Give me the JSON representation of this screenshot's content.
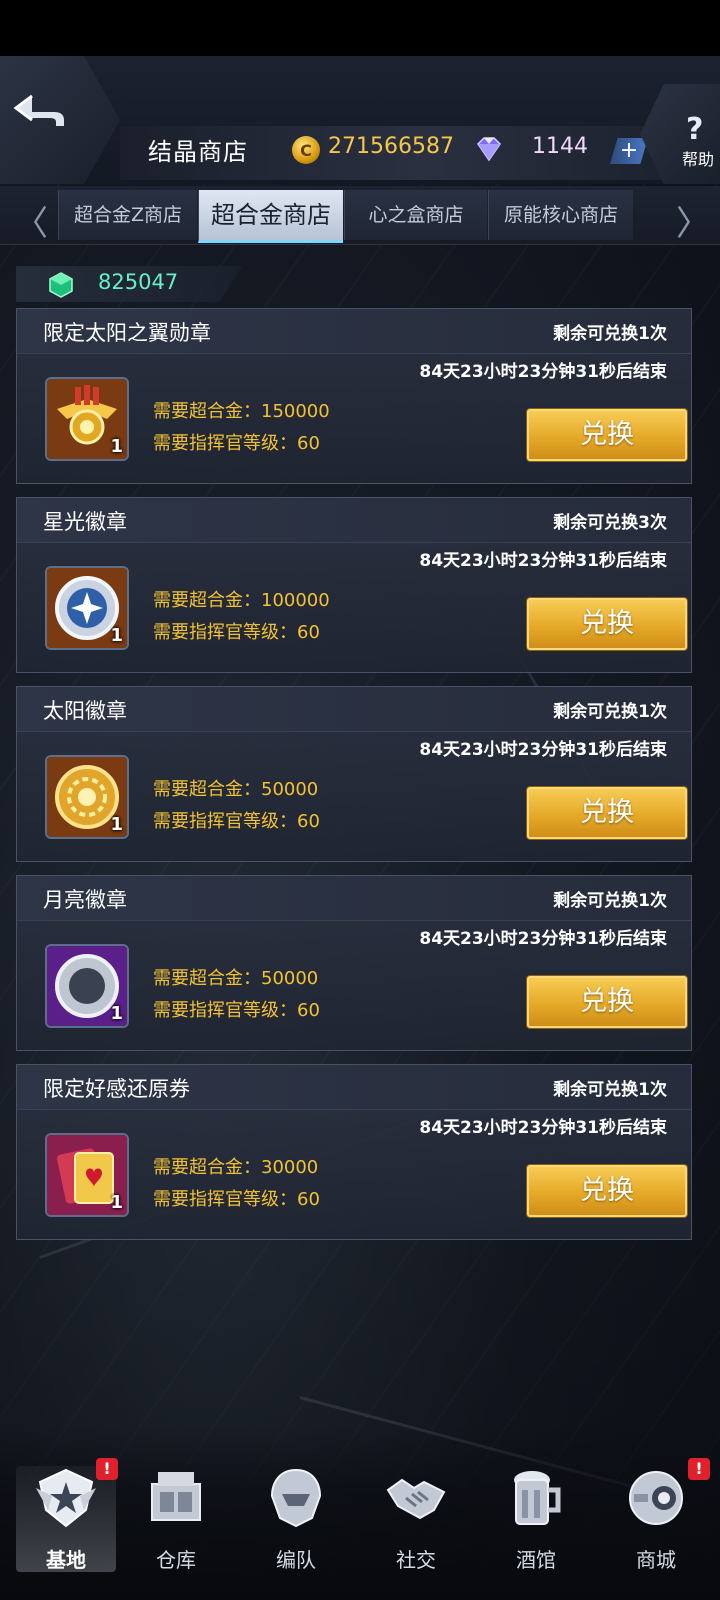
{
  "header": {
    "title": "结晶商店",
    "coins": "271566587",
    "gems": "1144",
    "plus_label": "+",
    "help_symbol": "?",
    "help_label": "帮助"
  },
  "tabs": [
    {
      "label": "超合金Z商店",
      "active": false
    },
    {
      "label": "超合金商店",
      "active": true
    },
    {
      "label": "心之盒商店",
      "active": false
    },
    {
      "label": "原能核心商店",
      "active": false
    }
  ],
  "tab_arrows": {
    "left": "〈",
    "right": "〉"
  },
  "balance": {
    "value": "825047"
  },
  "items": [
    {
      "name": "限定太阳之翼勋章",
      "remain": "剩余可兑换1次",
      "timer": "84天23小时23分钟31秒后结束",
      "cost": "需要超合金：150000",
      "level": "需要指挥官等级：60",
      "qty": "1",
      "button": "兑换",
      "icon": "sun-wing-medal-icon"
    },
    {
      "name": "星光徽章",
      "remain": "剩余可兑换3次",
      "timer": "84天23小时23分钟31秒后结束",
      "cost": "需要超合金：100000",
      "level": "需要指挥官等级：60",
      "qty": "1",
      "button": "兑换",
      "icon": "starlight-badge-icon"
    },
    {
      "name": "太阳徽章",
      "remain": "剩余可兑换1次",
      "timer": "84天23小时23分钟31秒后结束",
      "cost": "需要超合金：50000",
      "level": "需要指挥官等级：60",
      "qty": "1",
      "button": "兑换",
      "icon": "sun-badge-icon"
    },
    {
      "name": "月亮徽章",
      "remain": "剩余可兑换1次",
      "timer": "84天23小时23分钟31秒后结束",
      "cost": "需要超合金：50000",
      "level": "需要指挥官等级：60",
      "qty": "1",
      "button": "兑换",
      "icon": "moon-badge-icon"
    },
    {
      "name": "限定好感还原券",
      "remain": "剩余可兑换1次",
      "timer": "84天23小时23分钟31秒后结束",
      "cost": "需要超合金：30000",
      "level": "需要指挥官等级：60",
      "qty": "1",
      "button": "兑换",
      "icon": "affection-ticket-icon"
    }
  ],
  "nav": [
    {
      "label": "基地",
      "icon": "base-icon",
      "active": true,
      "badge": "!"
    },
    {
      "label": "仓库",
      "icon": "warehouse-icon",
      "active": false
    },
    {
      "label": "编队",
      "icon": "formation-icon",
      "active": false
    },
    {
      "label": "社交",
      "icon": "social-icon",
      "active": false
    },
    {
      "label": "酒馆",
      "icon": "tavern-icon",
      "active": false
    },
    {
      "label": "商城",
      "icon": "mall-icon",
      "active": false,
      "badge": "!"
    }
  ],
  "colors": {
    "gold": "#f2c233",
    "crystal": "#67f0c7",
    "accent_button": "#e5a928"
  }
}
